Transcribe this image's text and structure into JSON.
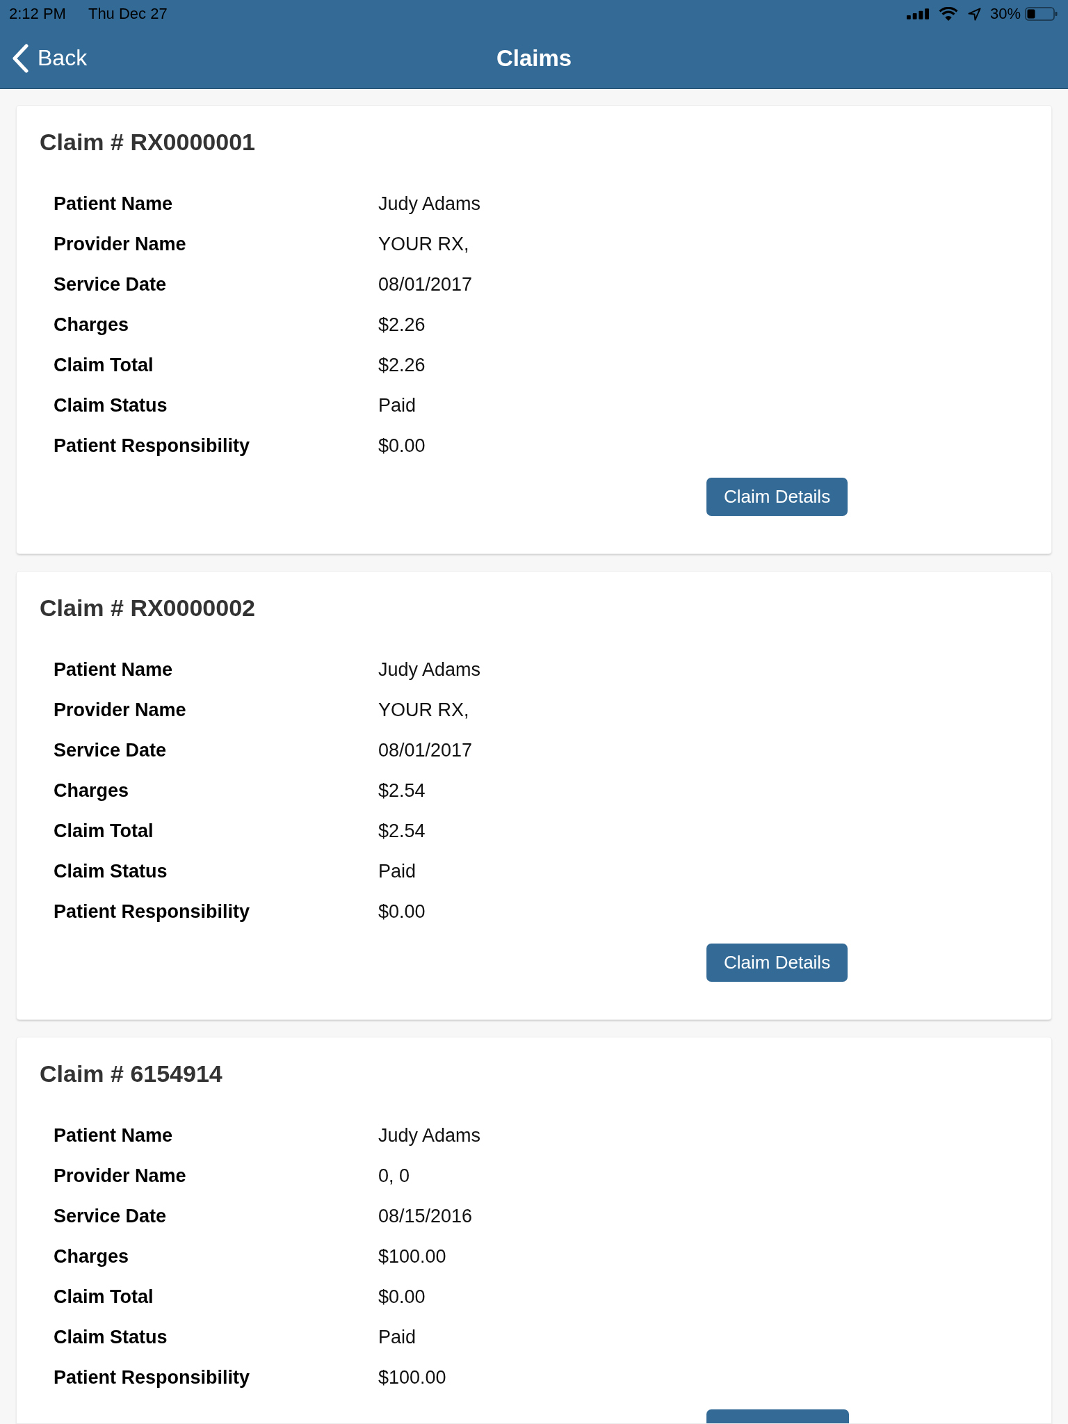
{
  "status_bar": {
    "time": "2:12 PM",
    "date": "Thu Dec 27",
    "battery": "30%"
  },
  "nav": {
    "back": "Back",
    "title": "Claims"
  },
  "claims": [
    {
      "title": "Claim # RX0000001",
      "fields": [
        {
          "label": "Patient Name",
          "value": "Judy Adams"
        },
        {
          "label": "Provider Name",
          "value": "YOUR RX,"
        },
        {
          "label": "Service Date",
          "value": "08/01/2017"
        },
        {
          "label": "Charges",
          "value": "$2.26"
        },
        {
          "label": "Claim Total",
          "value": "$2.26"
        },
        {
          "label": "Claim Status",
          "value": "Paid"
        },
        {
          "label": "Patient Responsibility",
          "value": "$0.00"
        }
      ],
      "button": {
        "label": "Claim Details",
        "cut_off": false
      }
    },
    {
      "title": "Claim # RX0000002",
      "fields": [
        {
          "label": "Patient Name",
          "value": "Judy Adams"
        },
        {
          "label": "Provider Name",
          "value": "YOUR RX,"
        },
        {
          "label": "Service Date",
          "value": "08/01/2017"
        },
        {
          "label": "Charges",
          "value": "$2.54"
        },
        {
          "label": "Claim Total",
          "value": "$2.54"
        },
        {
          "label": "Claim Status",
          "value": "Paid"
        },
        {
          "label": "Patient Responsibility",
          "value": "$0.00"
        }
      ],
      "button": {
        "label": "Claim Details",
        "cut_off": false
      }
    },
    {
      "title": "Claim # 6154914",
      "fields": [
        {
          "label": "Patient Name",
          "value": "Judy Adams"
        },
        {
          "label": "Provider Name",
          "value": "0, 0"
        },
        {
          "label": "Service Date",
          "value": "08/15/2016"
        },
        {
          "label": "Charges",
          "value": "$100.00"
        },
        {
          "label": "Claim Total",
          "value": "$0.00"
        },
        {
          "label": "Claim Status",
          "value": "Paid"
        },
        {
          "label": "Patient Responsibility",
          "value": "$100.00"
        }
      ],
      "button": {
        "cut_off": true
      }
    }
  ]
}
